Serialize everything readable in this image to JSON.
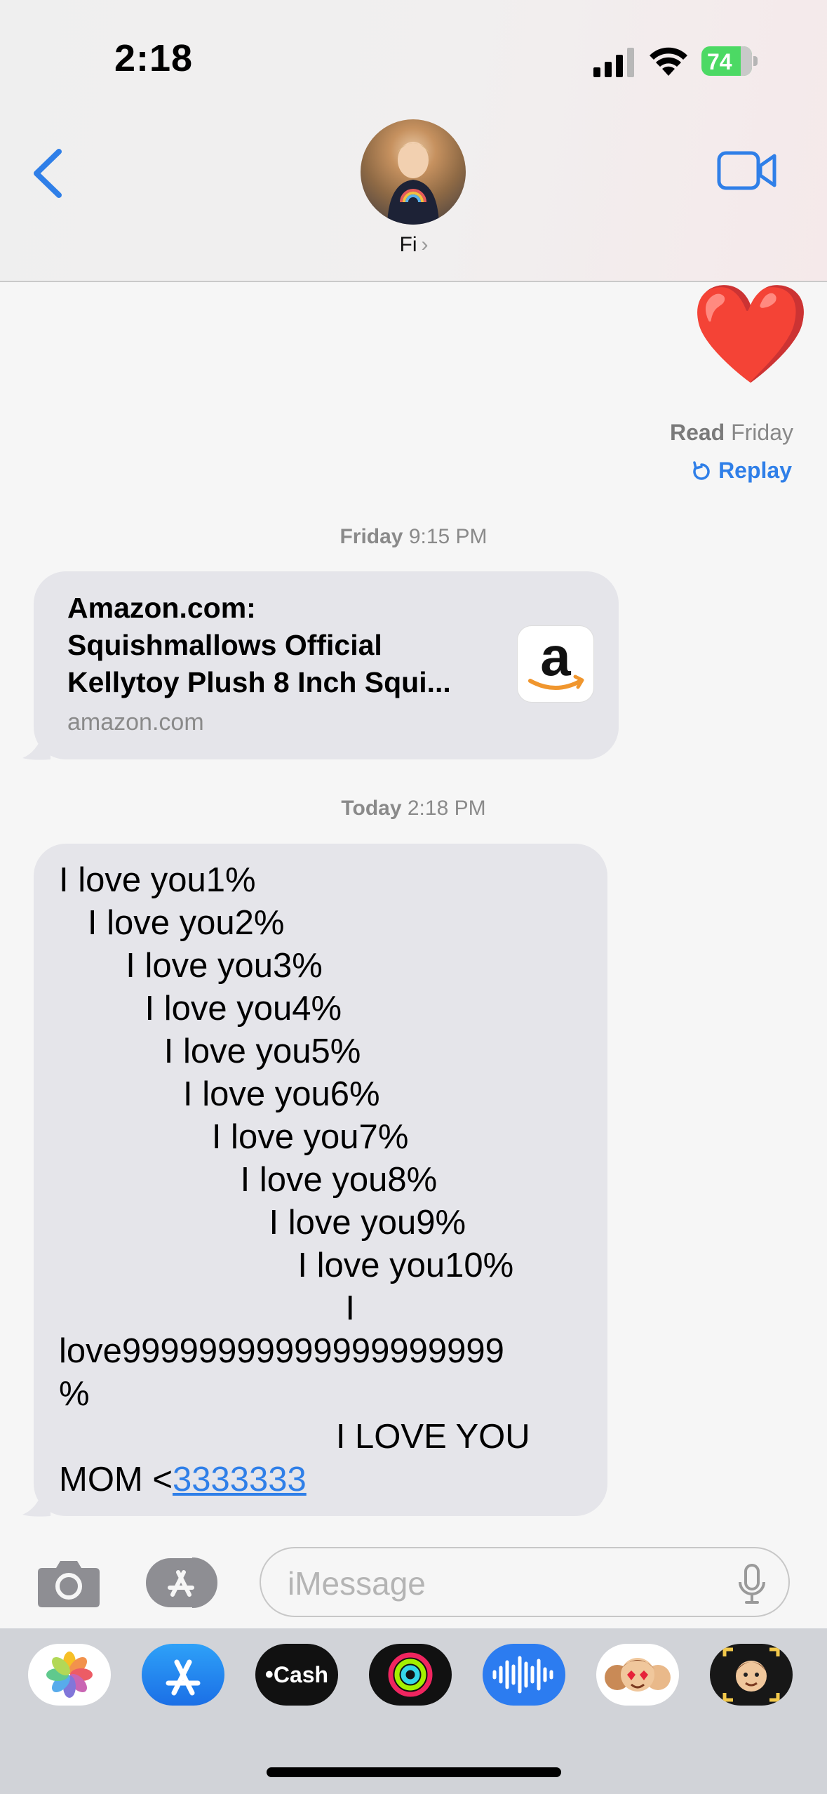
{
  "status_bar": {
    "time": "2:18",
    "battery": "74"
  },
  "header": {
    "contact_name": "Fi",
    "chevron": "›"
  },
  "messages": {
    "sent_emoji": "❤️",
    "read_label": "Read",
    "read_day": "Friday",
    "replay_label": "Replay",
    "stamp1_day": "Friday",
    "stamp1_time": "9:15 PM",
    "link_preview": {
      "title_line1": "Amazon.com:",
      "title_line2": "Squishmallows Official",
      "title_line3": "Kellytoy Plush 8 Inch Squi...",
      "domain": "amazon.com",
      "icon_letter": "a"
    },
    "stamp2_day": "Today",
    "stamp2_time": "2:18 PM",
    "received_text": "I love you1%\n   I love you2%\n       I love you3%\n         I love you4%\n           I love you5%\n             I love you6%\n                I love you7%\n                   I love you8%\n                      I love you9%\n                         I love you10%\n                              I\nlove99999999999999999999\n%\n                             I LOVE YOU\nMOM <",
    "received_link": "3333333"
  },
  "input": {
    "placeholder": "iMessage",
    "value": ""
  },
  "app_drawer": {
    "items": [
      "photos",
      "app-store",
      "apple-cash",
      "fitness",
      "audio-message",
      "memoji",
      "memoji-stickers"
    ],
    "cash_label": "Cash"
  },
  "colors": {
    "accent": "#2f7fe8",
    "bubble_gray": "#e5e5ea",
    "battery_green": "#4cd964"
  }
}
